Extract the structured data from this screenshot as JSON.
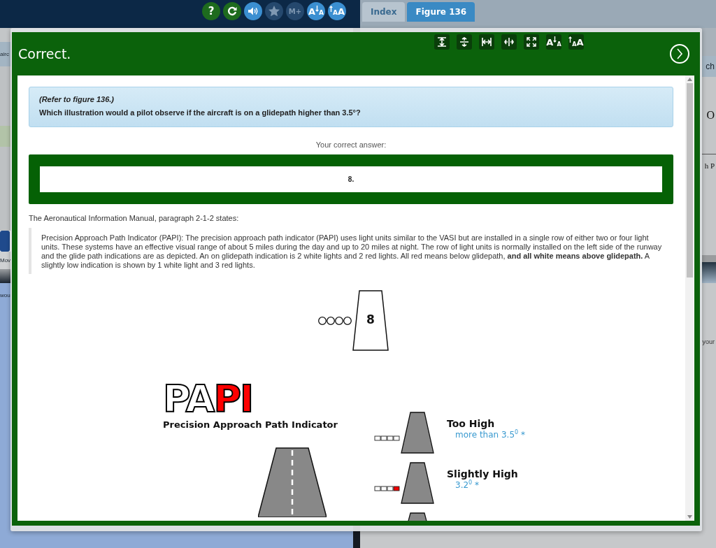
{
  "app_toolbar": [
    {
      "kind": "help",
      "glyph": "?",
      "color": "#1e6b1e",
      "disabled": false
    },
    {
      "kind": "refresh",
      "color": "#1e6b1e",
      "disabled": false
    },
    {
      "kind": "audio",
      "color": "#3b8fd1",
      "disabled": false
    },
    {
      "kind": "star",
      "color": "#25486d",
      "disabled": true
    },
    {
      "kind": "memo",
      "glyph": "M+",
      "color": "#25486d",
      "disabled": true
    },
    {
      "kind": "font-down",
      "glyph": [
        "A",
        "A"
      ],
      "color": "#3b8fd1",
      "disabled": false
    },
    {
      "kind": "font-up",
      "glyph": [
        "A",
        "A"
      ],
      "color": "#3b8fd1",
      "disabled": false
    }
  ],
  "tabs": [
    {
      "label": "Index",
      "selected": false
    },
    {
      "label": "Figure 136",
      "selected": true
    }
  ],
  "background_texts": {
    "left": [
      "airc",
      "Mov",
      "wou"
    ],
    "right": [
      "ch",
      "O",
      "h P",
      "your"
    ]
  },
  "modal": {
    "title": "Correct.",
    "tools": [
      {
        "kind": "fit-height"
      },
      {
        "kind": "expand-vertical"
      },
      {
        "kind": "fit-width"
      },
      {
        "kind": "expand-horizontal"
      },
      {
        "kind": "fullscreen"
      },
      {
        "kind": "font-down",
        "glyph": [
          "A",
          "A"
        ]
      },
      {
        "kind": "font-up",
        "glyph": [
          "A",
          "A"
        ]
      }
    ],
    "question": {
      "reference": "(Refer to figure 136.)",
      "text": "Which illustration would a pilot observe if the aircraft is on a glidepath higher than 3.5°?"
    },
    "answer_label": "Your correct answer:",
    "answer": "8.",
    "source": "The Aeronautical Information Manual, paragraph 2-1-2 states:",
    "quote": "Precision Approach Path Indicator (PAPI): The precision approach path indicator (PAPI) uses light units similar to the VASI but are installed in a single row of either two or four light units. These systems have an effective visual range of about 5 miles during the day and up to 20 miles at night. The row of light units is normally installed on the left side of the runway and the glide path indications are as depicted. An on glidepath indication is 2 white lights and 2 red lights. All red means below glidepath, **and all white means above glidepath.** A slightly low indication is shown by 1 white light and 3 red lights.",
    "figure": {
      "answer_diagram": {
        "label": "8",
        "lights": [
          {
            "red": false
          },
          {
            "red": false
          },
          {
            "red": false
          },
          {
            "red": false
          }
        ]
      },
      "logo": "PA**PI**",
      "subtitle": "Precision Approach Path Indicator",
      "indications": [
        {
          "title": "Too High",
          "detail": "more than 3.5$^{0}$ *",
          "lights": [
            {
              "red": false
            },
            {
              "red": false
            },
            {
              "red": false
            },
            {
              "red": false
            }
          ]
        },
        {
          "title": "Slightly High",
          "detail": "3.2$^{0}$ *",
          "lights": [
            {
              "red": false
            },
            {
              "red": false
            },
            {
              "red": false
            },
            {
              "red": true
            }
          ]
        }
      ]
    }
  }
}
